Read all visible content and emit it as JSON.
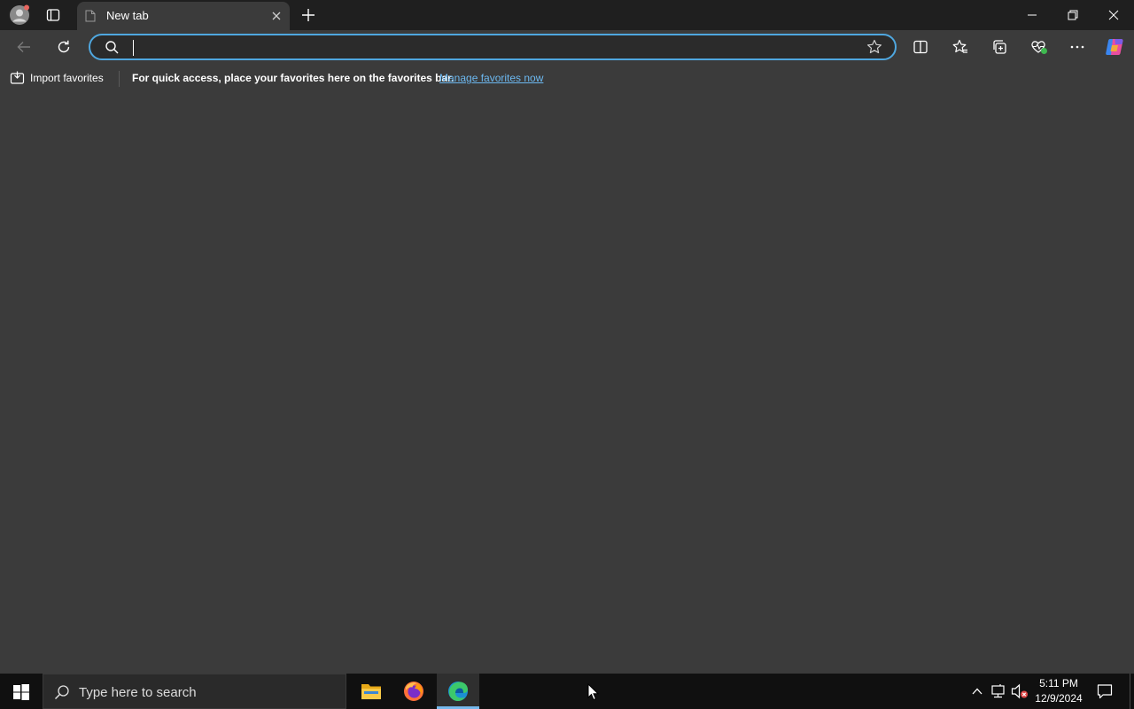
{
  "tab": {
    "title": "New tab"
  },
  "address_bar": {
    "value": "",
    "placeholder": ""
  },
  "favorites_bar": {
    "import_label": "Import favorites",
    "message": "For quick access, place your favorites here on the favorites bar.",
    "link": "Manage favorites now"
  },
  "taskbar": {
    "search_placeholder": "Type here to search",
    "time": "5:11 PM",
    "date": "12/9/2024"
  },
  "colors": {
    "tabstrip_bg": "#1f1f1f",
    "content_bg": "#3b3b3b",
    "address_focus": "#4fa7df",
    "link": "#6cb8f0",
    "taskbar_bg": "#101010"
  }
}
